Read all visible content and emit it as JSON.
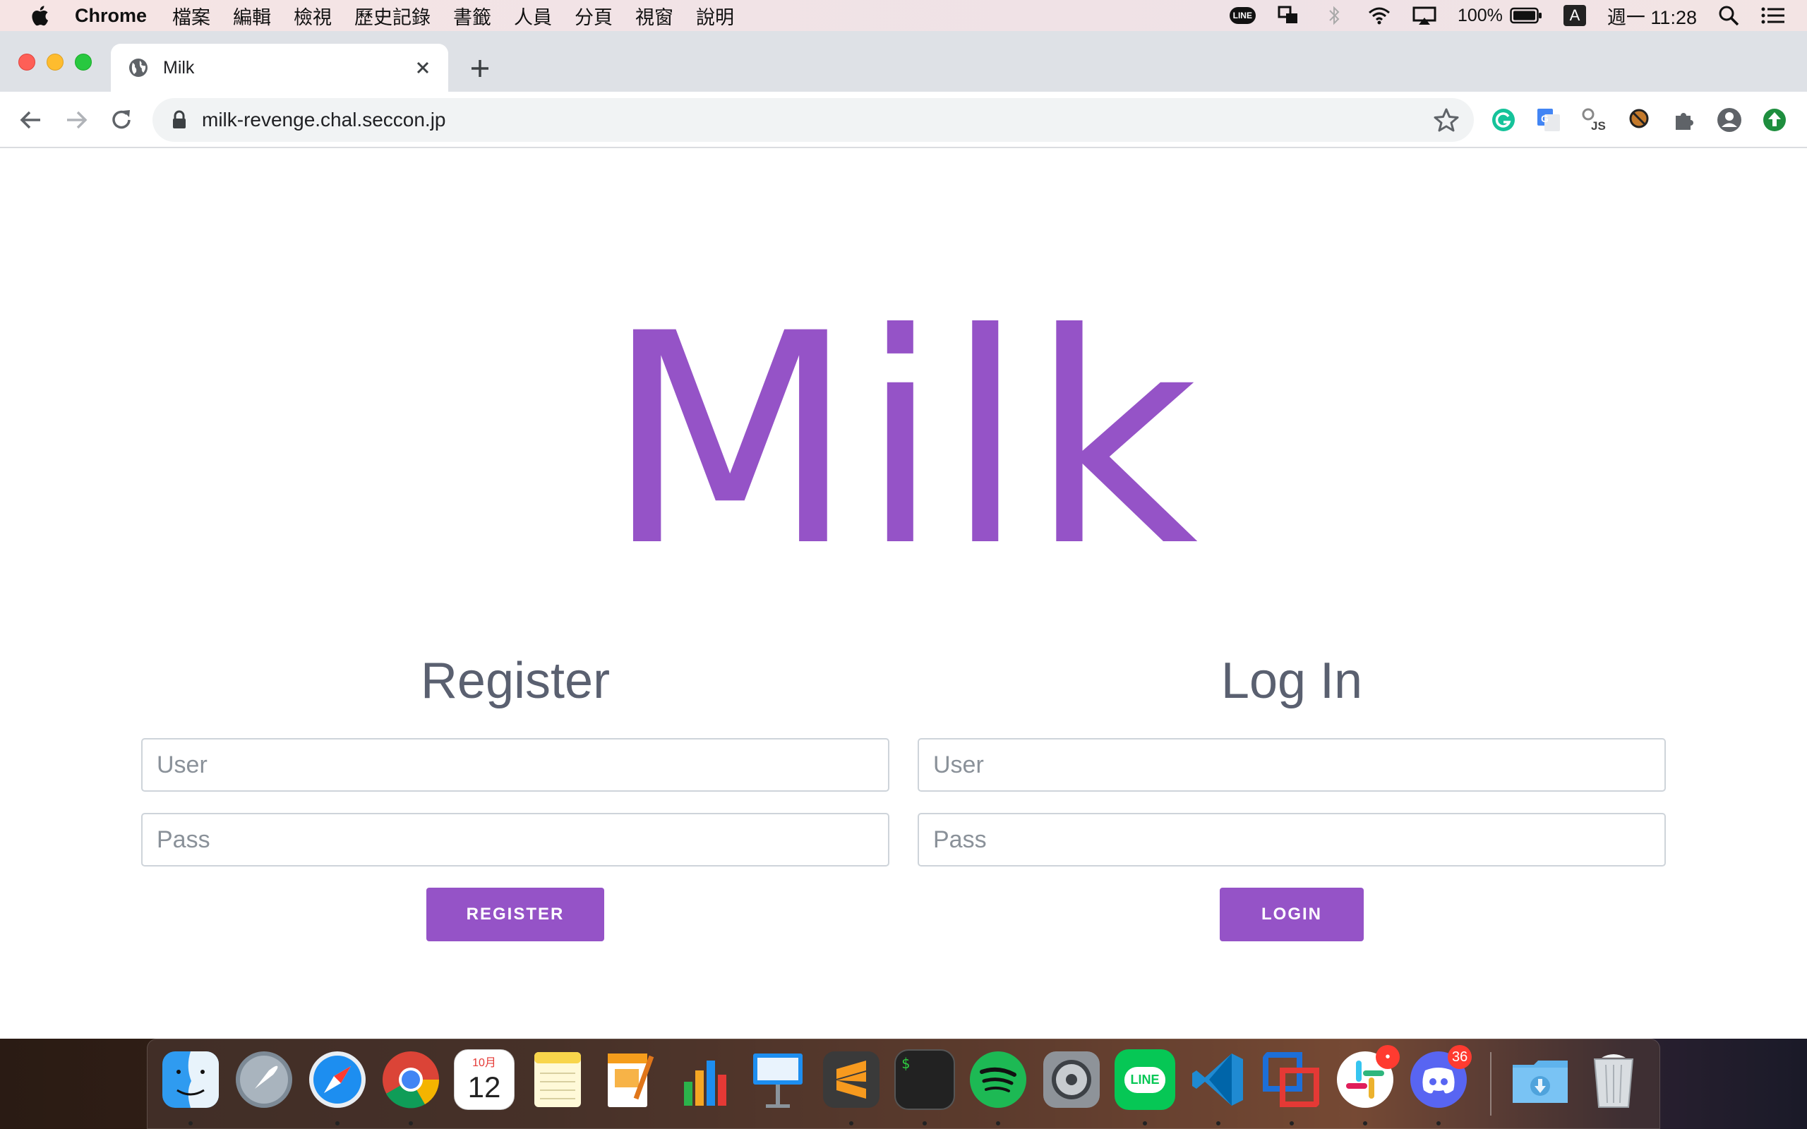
{
  "menubar": {
    "app_name": "Chrome",
    "menus": [
      "檔案",
      "編輯",
      "檢視",
      "歷史記錄",
      "書籤",
      "人員",
      "分頁",
      "視窗",
      "說明"
    ],
    "line_badge": "LINE",
    "battery": "100%",
    "input_source": "A",
    "clock": "週一 11:28"
  },
  "browser": {
    "tab_title": "Milk",
    "url": "milk-revenge.chal.seccon.jp"
  },
  "page": {
    "logo": "Milk",
    "register": {
      "heading": "Register",
      "user_placeholder": "User",
      "pass_placeholder": "Pass",
      "button": "REGISTER"
    },
    "login": {
      "heading": "Log In",
      "user_placeholder": "User",
      "pass_placeholder": "Pass",
      "button": "LOGIN"
    },
    "accent_color": "#9553c7"
  },
  "dock": {
    "calendar_month": "10月",
    "calendar_day": "12",
    "slack_badge": "•",
    "discord_badge": "36",
    "terminal_prompt": "$"
  }
}
